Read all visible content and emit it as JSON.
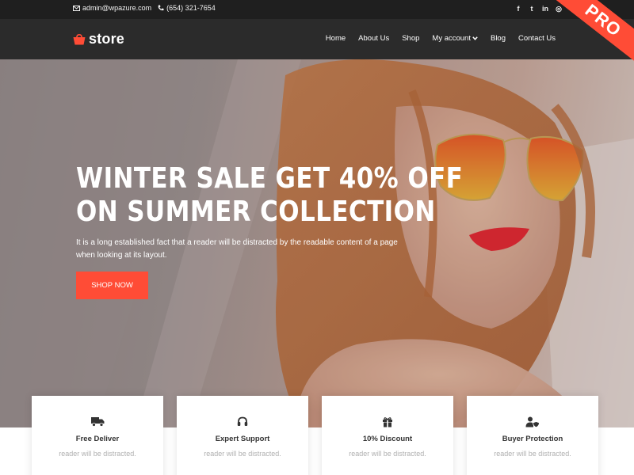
{
  "topbar": {
    "email": "admin@wpazure.com",
    "phone": "(654) 321-7654",
    "social": [
      {
        "icon": "facebook-icon",
        "glyph": "f"
      },
      {
        "icon": "twitter-icon",
        "glyph": "t"
      },
      {
        "icon": "linkedin-icon",
        "glyph": "in"
      },
      {
        "icon": "instagram-icon",
        "glyph": "◎"
      }
    ]
  },
  "header": {
    "logo": "store",
    "nav": [
      "Home",
      "About Us",
      "Shop",
      "My account",
      "Blog",
      "Contact Us"
    ]
  },
  "ribbon": "PRO",
  "hero": {
    "title_line1": "WINTER SALE GET 40% OFF",
    "title_line2": "ON SUMMER COLLECTION",
    "text_line1": "It is a long established fact that a reader will be distracted by the readable content of a page",
    "text_line2": "when looking at its layout.",
    "button": "SHOP NOW"
  },
  "features": [
    {
      "icon": "truck-icon",
      "title": "Free Deliver",
      "desc": "reader will be distracted."
    },
    {
      "icon": "headphones-icon",
      "title": "Expert Support",
      "desc": "reader will be distracted."
    },
    {
      "icon": "gift-icon",
      "title": "10% Discount",
      "desc": "reader will be distracted."
    },
    {
      "icon": "user-shield-icon",
      "title": "Buyer Protection",
      "desc": "reader will be distracted."
    }
  ],
  "colors": {
    "accent": "#ff4c36",
    "topbar": "#1f1f1f",
    "header": "#2b2b2b"
  }
}
